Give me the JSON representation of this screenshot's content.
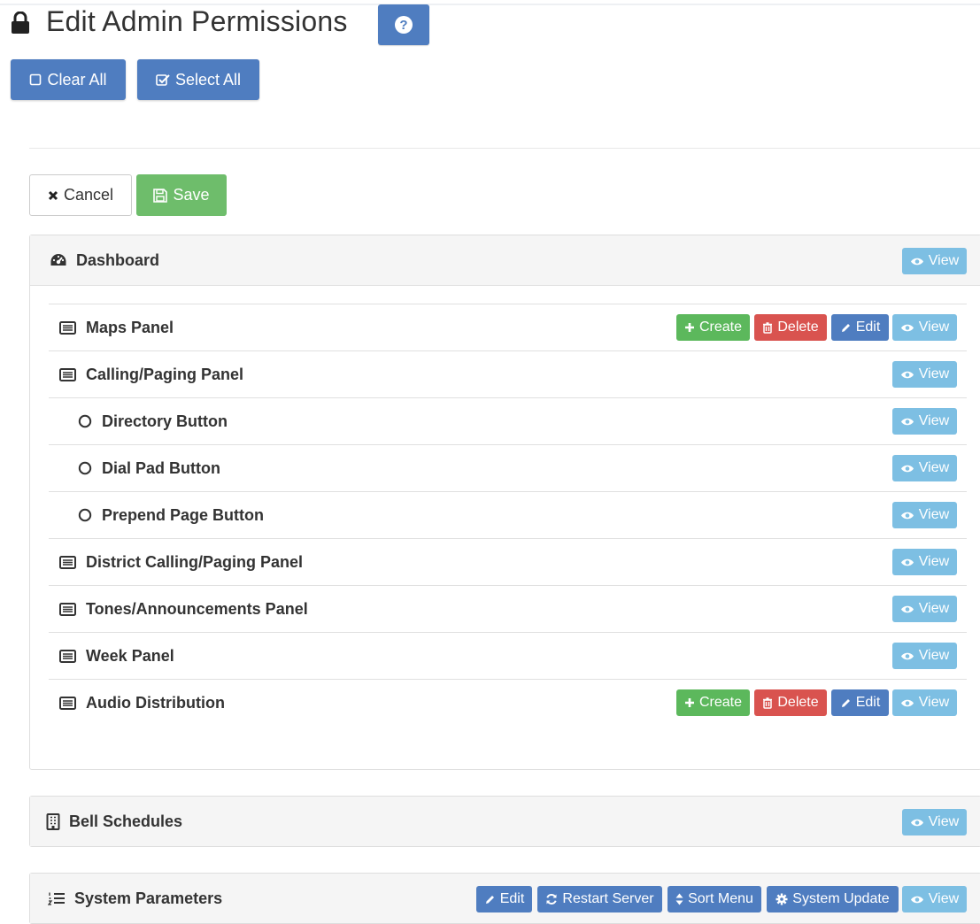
{
  "header": {
    "title": "Edit Admin Permissions",
    "help_icon": "question-circle-icon",
    "lock_icon": "lock-icon"
  },
  "toolbar": {
    "clear_all": "Clear All",
    "select_all": "Select All"
  },
  "form_actions": {
    "cancel": "Cancel",
    "save": "Save"
  },
  "buttons": {
    "view": "View",
    "edit": "Edit",
    "delete": "Delete",
    "create": "Create",
    "restart_server": "Restart Server",
    "sort_menu": "Sort Menu",
    "system_update": "System Update"
  },
  "sections": {
    "dashboard": {
      "title": "Dashboard",
      "icon": "dashboard-icon",
      "items": [
        {
          "label": "Maps Panel",
          "icon": "list-alt-icon"
        },
        {
          "label": "Calling/Paging Panel",
          "icon": "list-alt-icon"
        },
        {
          "label": "Directory Button",
          "icon": "circle-outline-icon"
        },
        {
          "label": "Dial Pad Button",
          "icon": "circle-outline-icon"
        },
        {
          "label": "Prepend Page Button",
          "icon": "circle-outline-icon"
        },
        {
          "label": "District Calling/Paging Panel",
          "icon": "list-alt-icon"
        },
        {
          "label": "Tones/Announcements Panel",
          "icon": "list-alt-icon"
        },
        {
          "label": "Week Panel",
          "icon": "list-alt-icon"
        },
        {
          "label": "Audio Distribution",
          "icon": "list-alt-icon"
        }
      ]
    },
    "bell_schedules": {
      "title": "Bell Schedules",
      "icon": "building-icon"
    },
    "system_parameters": {
      "title": "System Parameters",
      "icon": "list-ol-icon"
    }
  },
  "colors": {
    "primary": "#4f7dc0",
    "success": "#5cb85c",
    "danger": "#d9534f",
    "info": "#7dbfe3"
  }
}
